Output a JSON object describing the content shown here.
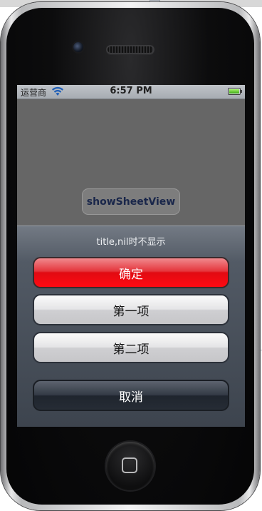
{
  "status_bar": {
    "carrier": "运营商",
    "time": "6:57 PM"
  },
  "app": {
    "show_button_label": "showSheetView"
  },
  "action_sheet": {
    "title": "title,nil时不显示",
    "destructive_label": "确定",
    "other_buttons": [
      "第一项",
      "第二项"
    ],
    "cancel_label": "取消"
  },
  "colors": {
    "destructive": "#e10a12",
    "sheet_bg": "#4a515c",
    "show_button_text": "#19264a"
  },
  "icons": [
    "wifi-icon",
    "battery-icon",
    "home-button-icon",
    "camera-icon",
    "speaker-icon"
  ]
}
